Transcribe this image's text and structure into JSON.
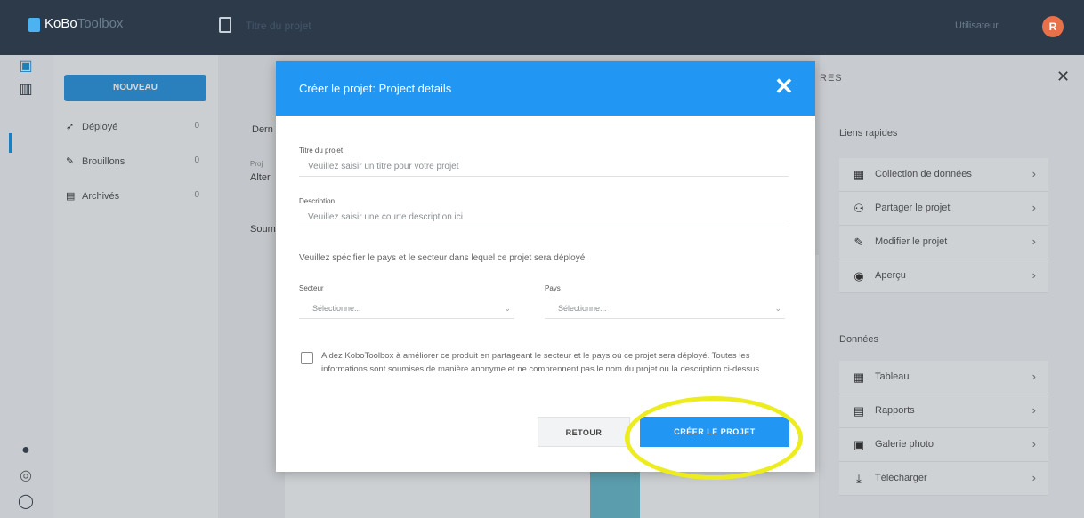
{
  "header": {
    "logo_main": "KoBo",
    "logo_light": "Toolbox",
    "project_name": "Titre du projet",
    "username": "Utilisateur",
    "avatar_letter": "R"
  },
  "sidebar": {
    "new_button": "NOUVEAU",
    "items": [
      {
        "label": "Déployé",
        "count": "0",
        "icon": "rocket-icon"
      },
      {
        "label": "Brouillons",
        "count": "0",
        "icon": "draft-icon"
      },
      {
        "label": "Archivés",
        "count": "0",
        "icon": "archive-icon"
      }
    ]
  },
  "background": {
    "frag1": "Dern",
    "frag2": "Proj",
    "frag3": "Alter",
    "frag4": "Soum"
  },
  "right_panel": {
    "title": "RES",
    "section_quick": "Liens rapides",
    "quick_links": [
      {
        "label": "Collection de données",
        "icon": "collect-icon"
      },
      {
        "label": "Partager le projet",
        "icon": "share-user-icon"
      },
      {
        "label": "Modifier le projet",
        "icon": "pencil-icon"
      },
      {
        "label": "Aperçu",
        "icon": "eye-icon"
      }
    ],
    "section_data": "Données",
    "data_links": [
      {
        "label": "Tableau",
        "icon": "table-icon"
      },
      {
        "label": "Rapports",
        "icon": "report-icon"
      },
      {
        "label": "Galerie photo",
        "icon": "gallery-icon"
      },
      {
        "label": "Télécharger",
        "icon": "download-icon"
      }
    ]
  },
  "modal": {
    "title": "Créer le projet: Project details",
    "close": "✕",
    "project_title_label": "Titre du projet",
    "project_title_placeholder": "Veuillez saisir un titre pour votre projet",
    "description_label": "Description",
    "description_placeholder": "Veuillez saisir une courte description ici",
    "hint": "Veuillez spécifier le pays et le secteur dans lequel ce projet sera déployé",
    "sector_label": "Secteur",
    "sector_value": "Sélectionne...",
    "country_label": "Pays",
    "country_value": "Sélectionne...",
    "consent_text": "Aidez KoboToolbox à améliorer ce produit en partageant le secteur et le pays où ce projet sera déployé. Toutes les informations sont soumises de manière anonyme et ne comprennent pas le nom du projet ou la description ci-dessus.",
    "back_button": "RETOUR",
    "create_button": "CRÉER LE PROJET"
  },
  "colors": {
    "topbar": "#2c3a4a",
    "accent": "#2196f3",
    "highlight": "#ecec1f"
  }
}
